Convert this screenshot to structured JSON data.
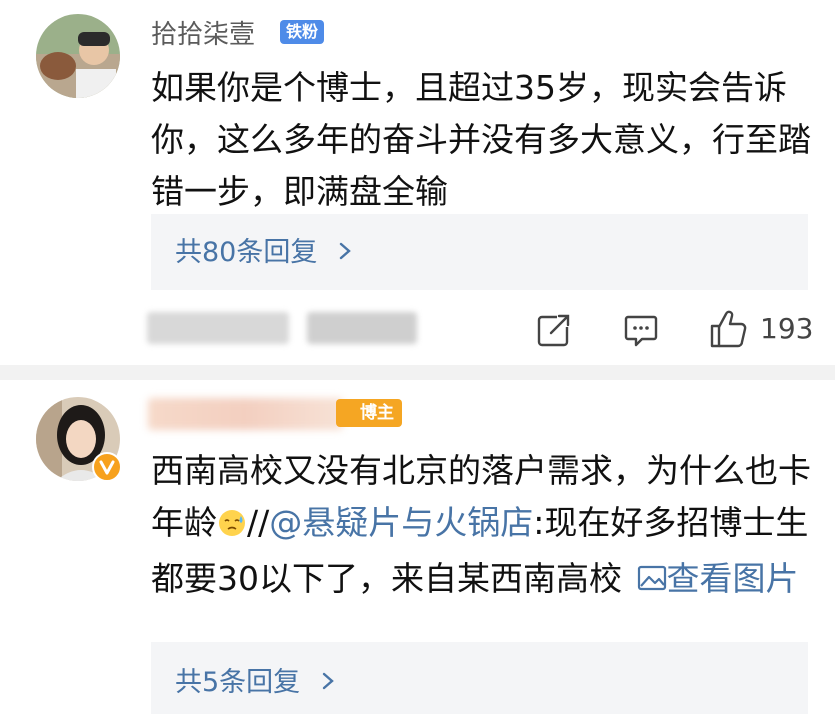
{
  "comment1": {
    "username": "拾拾柒壹",
    "badge": "铁粉",
    "text": "如果你是个博士，且超过35岁，现实会告诉你，这么多年的奋斗并没有多大意义，行至踏错一步，即满盘全输",
    "replies_label": "共80条回复",
    "like_count": "193",
    "icons": [
      "avatar",
      "forward-icon",
      "comment-icon",
      "like-icon"
    ]
  },
  "comment2": {
    "badge": "博主",
    "text_main": "西南高校又没有北京的落户需求，为什么也卡年龄",
    "mention_prefix": "//",
    "mention": "@悬疑片与火锅店",
    "quote_text": ":现在好多招博士生都要30以下了，来自某西南高校",
    "view_image": "查看图片",
    "replies_label": "共5条回复",
    "icons": [
      "avatar",
      "verified-icon",
      "image-icon",
      "sweat-emoji"
    ]
  },
  "colors": {
    "link": "#4874a6",
    "iron_badge": "#4e8be8",
    "blogger_badge": "#f5a623",
    "reply_bg": "#f4f5f7",
    "divider": "#f2f2f2"
  }
}
